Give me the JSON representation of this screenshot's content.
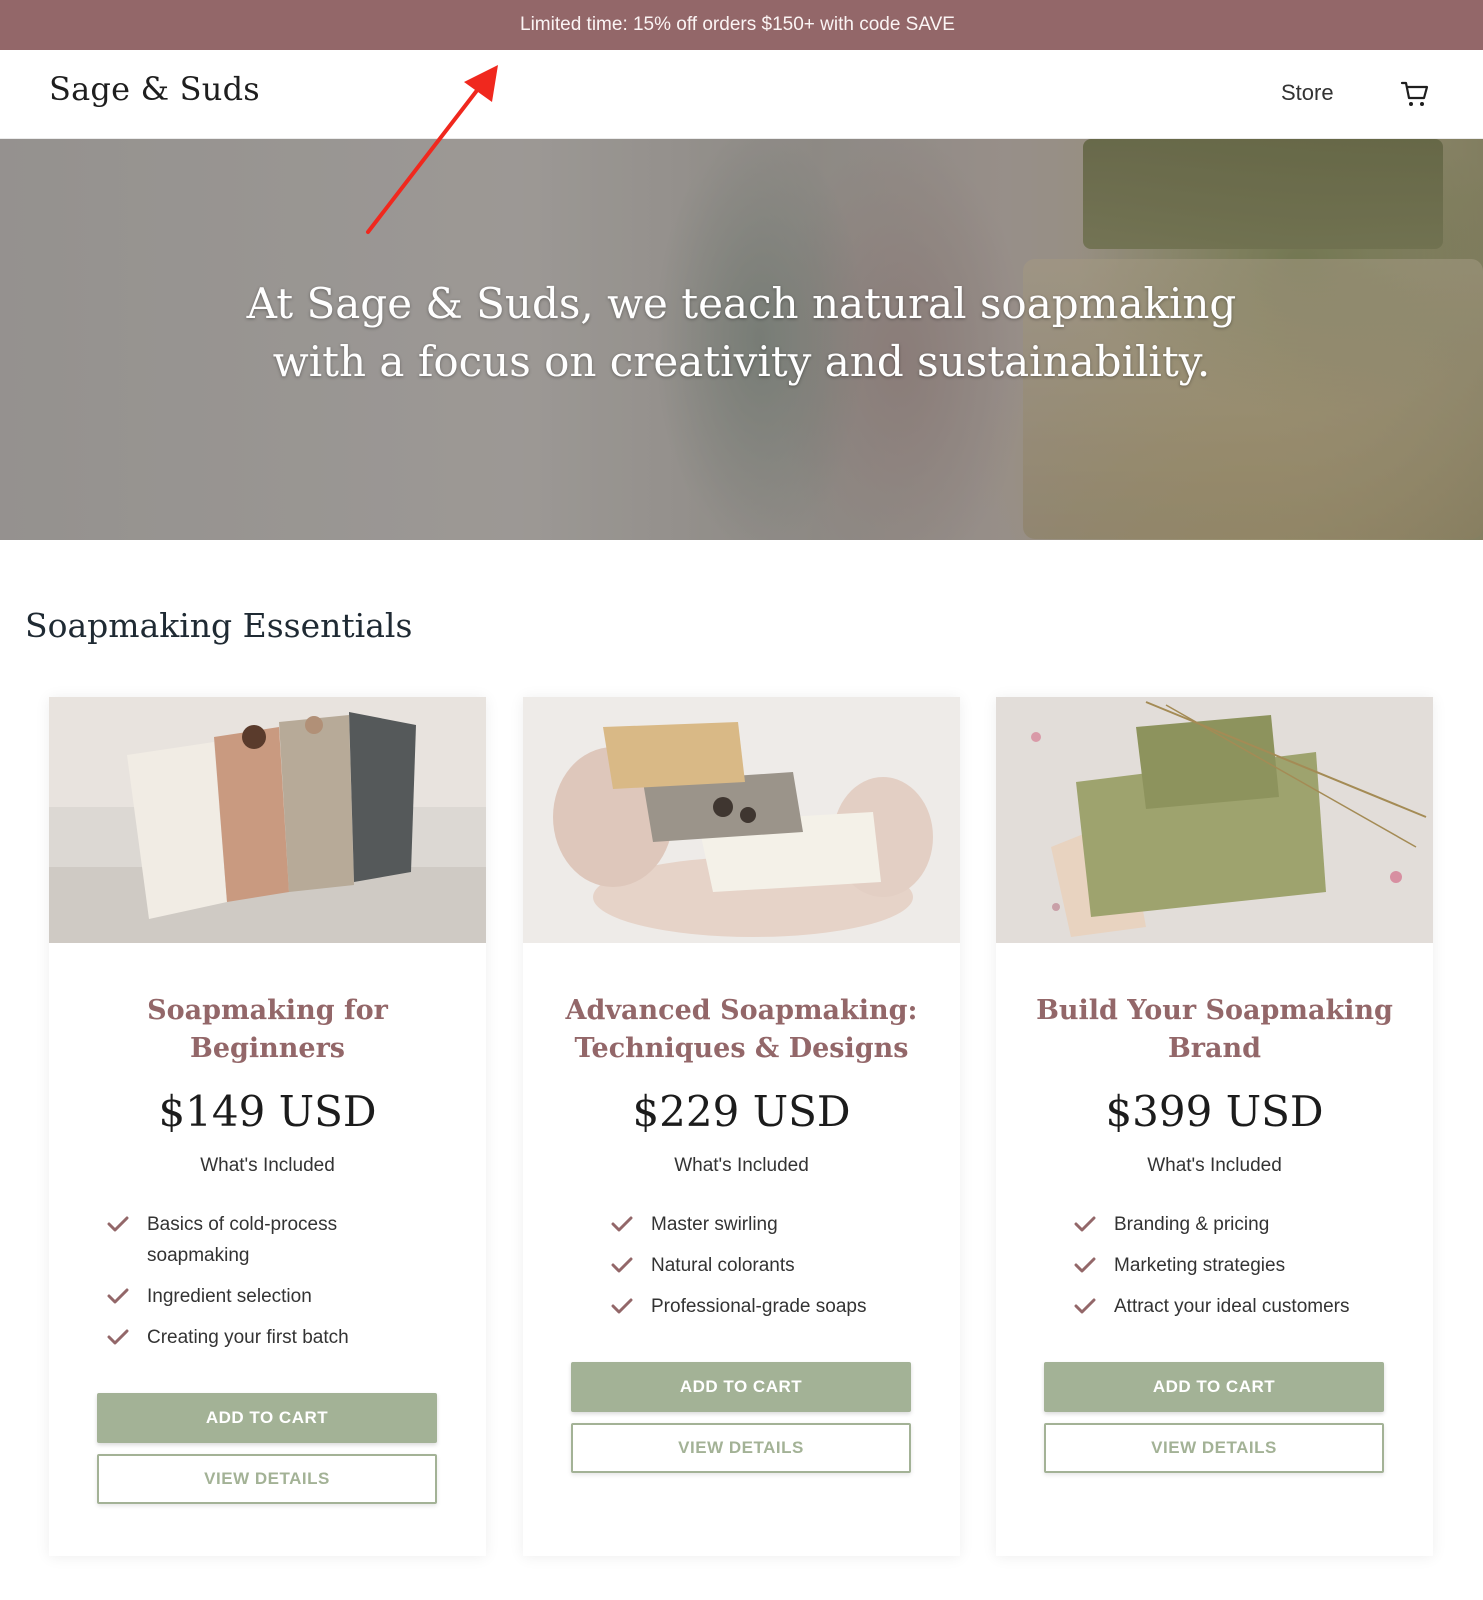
{
  "announcement": "Limited time: 15% off orders $150+ with code SAVE",
  "header": {
    "logo": "Sage & Suds",
    "nav_store": "Store",
    "cart_icon": "cart-icon"
  },
  "hero": {
    "text_line1": "At Sage & Suds, we teach natural soapmaking",
    "text_line2": "with a focus on creativity and sustainability."
  },
  "section_title": "Soapmaking Essentials",
  "colors": {
    "accent": "#936769",
    "sage": "#a3b296",
    "announcement_bg": "#936769"
  },
  "cards": [
    {
      "title_line1": "Soapmaking for",
      "title_line2": "Beginners",
      "price": "$149 USD",
      "included_label": "What's Included",
      "features": [
        "Basics of cold-process soapmaking",
        "Ingredient selection",
        "Creating your first batch"
      ],
      "add_label": "ADD TO CART",
      "view_label": "VIEW DETAILS"
    },
    {
      "title_line1": "Advanced Soapmaking:",
      "title_line2": "Techniques & Designs",
      "price": "$229 USD",
      "included_label": "What's Included",
      "features": [
        "Master swirling",
        "Natural colorants",
        "Professional-grade soaps"
      ],
      "add_label": "ADD TO CART",
      "view_label": "VIEW DETAILS"
    },
    {
      "title_line1": "Build Your Soapmaking",
      "title_line2": "Brand",
      "price": "$399 USD",
      "included_label": "What's Included",
      "features": [
        "Branding & pricing",
        "Marketing strategies",
        "Attract your ideal customers"
      ],
      "add_label": "ADD TO CART",
      "view_label": "VIEW DETAILS"
    }
  ]
}
